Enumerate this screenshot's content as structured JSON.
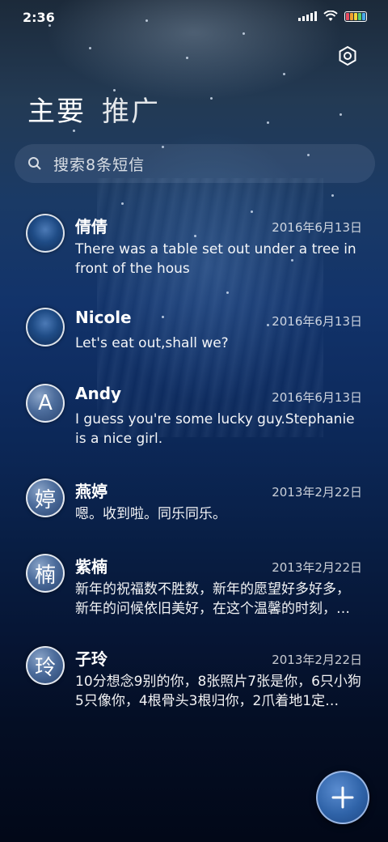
{
  "status_bar": {
    "time": "2:36",
    "icons": [
      "signal-icon",
      "wifi-icon",
      "battery-icon"
    ],
    "battery_colors": [
      "#e84a5f",
      "#f0a030",
      "#f5d63a",
      "#5cd06a",
      "#4aa8e8"
    ]
  },
  "header": {
    "settings_icon": "settings-icon",
    "tabs": [
      {
        "label": "主要",
        "active": true
      },
      {
        "label": "推广",
        "active": false
      }
    ]
  },
  "search": {
    "placeholder": "搜索8条短信",
    "icon": "search-icon"
  },
  "conversations": [
    {
      "name": "倩倩",
      "avatar": "",
      "date": "2016年6月13日",
      "snippet": "There was a table set out under a tree in front of the hous"
    },
    {
      "name": "Nicole",
      "avatar": "",
      "date": "2016年6月13日",
      "snippet": "Let's eat out,shall we?"
    },
    {
      "name": "Andy",
      "avatar": "A",
      "date": "2016年6月13日",
      "snippet": "I guess you're some lucky guy.Stephanie is a nice girl."
    },
    {
      "name": "燕婷",
      "avatar": "婷",
      "date": "2013年2月22日",
      "snippet": "嗯。收到啦。同乐同乐。"
    },
    {
      "name": "紫楠",
      "avatar": "楠",
      "date": "2013年2月22日",
      "snippet": "新年的祝福数不胜数，新年的愿望好多好多，新年的问候依旧美好，在这个温馨的时刻，…"
    },
    {
      "name": "子玲",
      "avatar": "玲",
      "date": "2013年2月22日",
      "snippet": "10分想念9别的你，8张照片7张是你，6只小狗5只像你，4根骨头3根归你，2爪着地1定…"
    }
  ],
  "fab": {
    "icon": "plus-icon",
    "accent": "#2f63a8"
  }
}
